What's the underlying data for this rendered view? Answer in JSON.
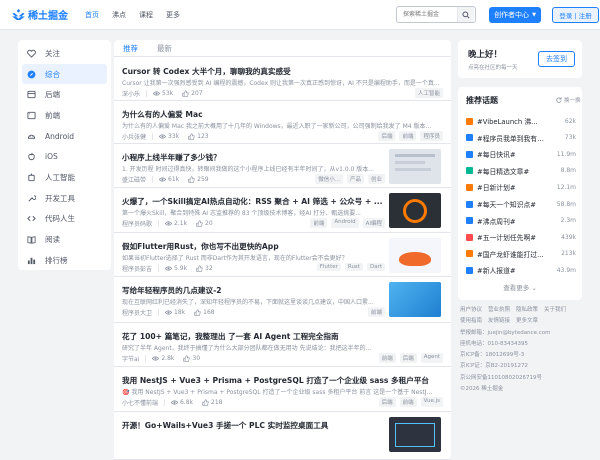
{
  "app": {
    "logo": "稀土掘金"
  },
  "nav": [
    "首页",
    "沸点",
    "课程",
    "更多"
  ],
  "search": {
    "placeholder": "探索稀土掘金"
  },
  "buttons": {
    "creator": "创作者中心",
    "login": "登录 | 注册"
  },
  "sidebar": [
    "关注",
    "综合",
    "后端",
    "前端",
    "Android",
    "iOS",
    "人工智能",
    "开发工具",
    "代码人生",
    "阅读",
    "排行榜"
  ],
  "feed_tabs": [
    "推荐",
    "最新"
  ],
  "articles": [
    {
      "title": "Cursor 转 Codex 大半个月，聊聊我的真实感受",
      "desc": "Cursor 让我第一次强烈感受到 AI 编程的震撼，Codex 则让我第一次真正感到惊讶，AI 不只是编程助手，而是一个真...",
      "author": "深小乐",
      "views": "53k",
      "likes": "207",
      "tags": [
        "人工智能"
      ]
    },
    {
      "title": "为什么有的人偏爱 Mac",
      "desc": "为什么有的人偏爱 Mac 我之前大概用了十几年的 Windows，最近入职了一家新公司，公司强制给我发了 M4 版本...",
      "author": "小兵张健",
      "views": "33k",
      "likes": "123",
      "tags": [
        "后端",
        "前端",
        "程序员"
      ]
    },
    {
      "title": "小程序上线半年赚了多少钱？",
      "desc": "1. 开发历程 时间过得真快，转眼间我做的这个小程序上线已经有半年时间了，从v1.0.0 版本...",
      "author": "盛江磁带",
      "views": "61k",
      "likes": "259",
      "tags": [
        "微信小...",
        "产品",
        "创业"
      ]
    },
    {
      "title": "火爆了，一个Skill搞定AI热点自动化：RSS 聚合 + AI 筛选 + 公众号 + ...",
      "desc": "第一个爆火Skill，聚合到特殊 AI 志监推荐的 83 个顶级技术博客，经AI 打分、甄选挑要...",
      "author": "程序员码歌",
      "views": "2.1k",
      "likes": "20",
      "tags": [
        "前端",
        "Android",
        "AI编程"
      ]
    },
    {
      "title": "假如Flutter用Rust，你也写不出更快的App",
      "desc": "如果当初Flutter选择了 Rust 而非Dart作为其开发语言，现在的Flutter会不会更好？",
      "author": "程序员彭吉",
      "views": "5.9k",
      "likes": "32",
      "tags": [
        "Flutter",
        "Rust",
        "Dart"
      ]
    },
    {
      "title": "写给年轻程序员的几点建议-2",
      "desc": "现在互联网红利已经消失了，深知年轻程序员的不易，下面就这里谈谈几点建议，中国人口累...",
      "author": "程序员大卫",
      "views": "18k",
      "likes": "168",
      "tags": [
        "前端"
      ]
    },
    {
      "title": "花了 100+ 篇笔记，我整理出 了一套 AI Agent 工程完全指南",
      "desc": "研究了半年 Agent，我终于搞懂了为什么大部分团队都在做无用功 先说结论：我把这半年的...",
      "author": "字节ai",
      "views": "2.8k",
      "likes": "30",
      "tags": [
        "前端",
        "后端",
        "Agent"
      ]
    },
    {
      "title": "我用 NestJS + Vue3 + Prisma + PostgreSQL 打造了一个企业级 sass 多租户平台",
      "desc": "🎯 我用 NestJS + Vue3 + Prisma + PostgreSQL 打造了一个企业级 sass 多租户平台 前言 这是一个基于 NestJ...",
      "author": "小七不懂前端",
      "views": "6.8k",
      "likes": "218",
      "tags": [
        "后端",
        "前端",
        "Vue.js"
      ]
    },
    {
      "title": "开源！Go+Wails+Vue3 手搓一个 PLC 实时监控桌面工具",
      "desc": "",
      "author": "",
      "views": "",
      "likes": "",
      "tags": []
    }
  ],
  "greeting": {
    "title": "晚上好！",
    "sub": "点亮在社区的每一天",
    "signin": "去签到"
  },
  "hot": {
    "title": "推荐话题",
    "refresh": "换一换",
    "more": "查看更多",
    "items": [
      {
        "name": "#VibeLaunch 沸...",
        "count": "62k",
        "color": "#ff7a00"
      },
      {
        "name": "#程序员我单到我有多...",
        "count": "73k",
        "color": "#1e80ff"
      },
      {
        "name": "#每日快讯#",
        "count": "11.9m",
        "color": "#1e80ff"
      },
      {
        "name": "#每日精选文章#",
        "count": "8.8m",
        "color": "#00b894"
      },
      {
        "name": "#日新计划#",
        "count": "12.1m",
        "color": "#ff7a00"
      },
      {
        "name": "#每天一个知识点#",
        "count": "58.8m",
        "color": "#1e80ff"
      },
      {
        "name": "#沸点周刊#",
        "count": "2.3m",
        "color": "#1e80ff"
      },
      {
        "name": "#五一计划任先啊#",
        "count": "439k",
        "color": "#ff4d4f"
      },
      {
        "name": "#国产龙虾谁能打过...",
        "count": "213k",
        "color": "#ff7a00"
      },
      {
        "name": "#新人报道#",
        "count": "43.9m",
        "color": "#1e80ff"
      }
    ]
  },
  "footer": [
    [
      "用户协议",
      "营业执照",
      "隐私政策",
      "关于我们"
    ],
    [
      "使用指南",
      "友情链接",
      "更多文章"
    ],
    [
      "举报邮箱：juejin@bytedance.com"
    ],
    [
      "座机电话：010-83434395"
    ],
    [
      "京ICP备：18012699号-3"
    ],
    [
      "京ICP证：京B2-20191272"
    ],
    [
      "京公网安备11010802026719号"
    ],
    [
      "©2026 稀土掘金"
    ]
  ]
}
